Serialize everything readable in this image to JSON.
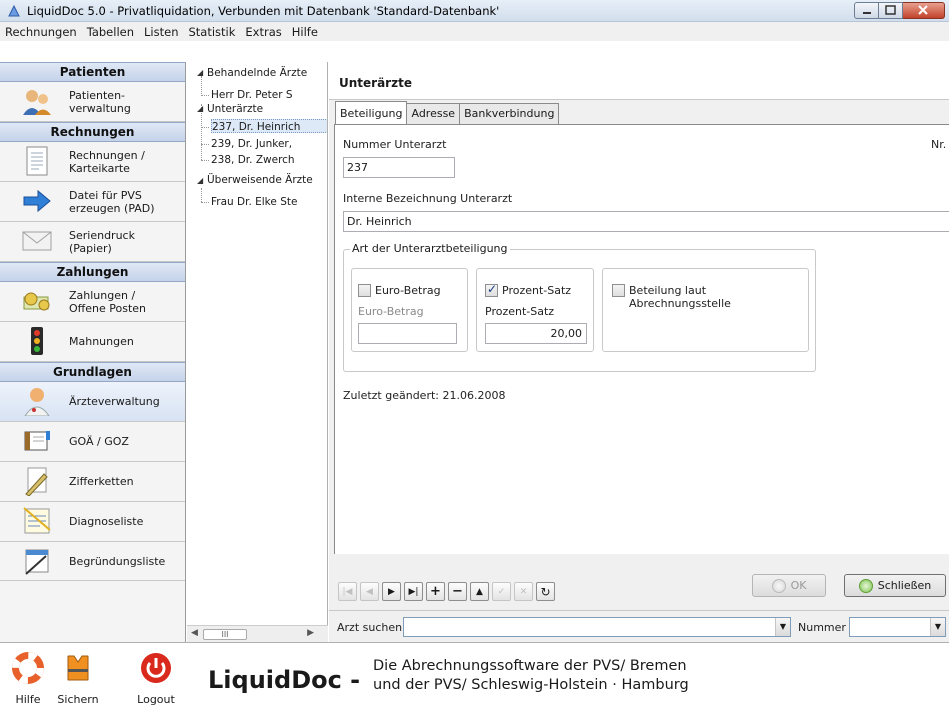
{
  "window": {
    "title": "LiquidDoc 5.0 - Privatliquidation, Verbunden mit Datenbank 'Standard-Datenbank'"
  },
  "menu": [
    "Rechnungen",
    "Tabellen",
    "Listen",
    "Statistik",
    "Extras",
    "Hilfe"
  ],
  "sidebar": {
    "sections": [
      {
        "title": "Patienten",
        "items": [
          {
            "label": "Patienten-\nverwaltung",
            "icon": "patients-icon"
          }
        ]
      },
      {
        "title": "Rechnungen",
        "items": [
          {
            "label": "Rechnungen /\nKarteikarte",
            "icon": "invoice-icon"
          },
          {
            "label": "Datei für PVS\nerzeugen (PAD)",
            "icon": "arrow-right-icon"
          },
          {
            "label": "Seriendruck\n(Papier)",
            "icon": "envelope-icon"
          }
        ]
      },
      {
        "title": "Zahlungen",
        "items": [
          {
            "label": "Zahlungen /\nOffene Posten",
            "icon": "money-icon"
          },
          {
            "label": "Mahnungen",
            "icon": "traffic-light-icon"
          }
        ]
      },
      {
        "title": "Grundlagen",
        "items": [
          {
            "label": "Ärzteverwaltung",
            "icon": "doctor-icon"
          },
          {
            "label": "GOÄ / GOZ",
            "icon": "book-icon"
          },
          {
            "label": "Zifferketten",
            "icon": "pencil-icon"
          },
          {
            "label": "Diagnoseliste",
            "icon": "list-icon"
          },
          {
            "label": "Begründungsliste",
            "icon": "notepad-icon"
          }
        ]
      }
    ]
  },
  "tree": {
    "nodes": [
      {
        "label": "Behandelnde Ärzte"
      },
      {
        "label": "Herr Dr. Peter S"
      },
      {
        "label": "Unterärzte"
      },
      {
        "label": "237, Dr. Heinrich"
      },
      {
        "label": "239, Dr. Junker,"
      },
      {
        "label": "238, Dr. Zwerch"
      },
      {
        "label": "Überweisende Ärzte"
      },
      {
        "label": "Frau Dr. Elke Ste"
      }
    ],
    "scroll_thumb": "III"
  },
  "main": {
    "header": "Unterärzte",
    "tabs": [
      "Beteiligung",
      "Adresse",
      "Bankverbindung"
    ],
    "form": {
      "nummer_label": "Nummer Unterarzt",
      "nummer_value": "237",
      "nr_label": "Nr.",
      "bezeichnung_label": "Interne Bezeichnung Unterarzt",
      "bezeichnung_value": "Dr. Heinrich",
      "group_label": "Art der Unterarztbeteiligung",
      "euro_checkbox": "Euro-Betrag",
      "euro_field_label": "Euro-Betrag",
      "euro_value": "",
      "prozent_checkbox": "Prozent-Satz",
      "prozent_field_label": "Prozent-Satz",
      "prozent_value": "20,00",
      "abrechnung_checkbox": "Beteilung laut Abrechnungsstelle",
      "last_changed": "Zuletzt geändert: 21.06.2008"
    },
    "buttons": {
      "ok": "OK",
      "close": "Schließen"
    },
    "search": {
      "label": "Arzt suchen",
      "value": "",
      "sort_label": "Nummer",
      "sort_value": ""
    }
  },
  "footer": {
    "buttons": [
      "Hilfe",
      "Sichern",
      "Logout"
    ],
    "logo": "LiquidDoc -",
    "tagline": "Die Abrechnungssoftware der PVS/ Bremen\nund der PVS/ Schleswig-Holstein · Hamburg"
  },
  "colors": {
    "section_header": "#c5d3ea",
    "selection": "#dde9f7",
    "accent": "#1c3c84"
  }
}
